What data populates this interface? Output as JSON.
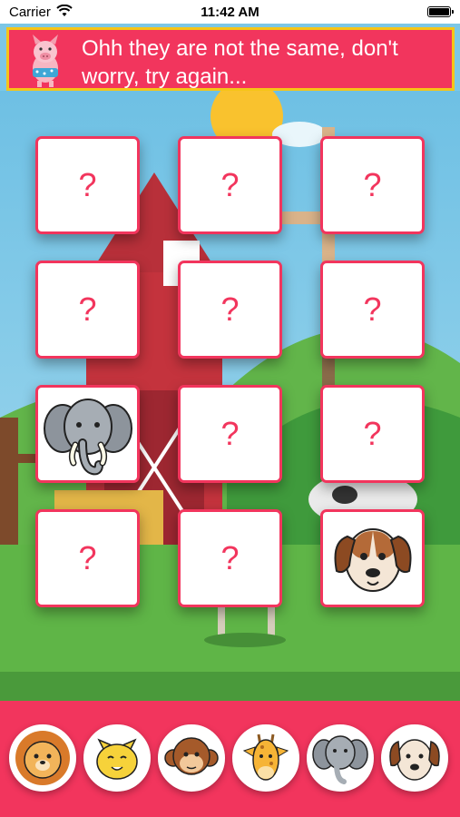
{
  "status_bar": {
    "carrier": "Carrier",
    "time": "11:42 AM"
  },
  "banner": {
    "message": "Ohh they are not the same, don't worry, try again..."
  },
  "board": {
    "cards": [
      {
        "state": "hidden",
        "label": "?"
      },
      {
        "state": "hidden",
        "label": "?"
      },
      {
        "state": "hidden",
        "label": "?"
      },
      {
        "state": "hidden",
        "label": "?"
      },
      {
        "state": "hidden",
        "label": "?"
      },
      {
        "state": "hidden",
        "label": "?"
      },
      {
        "state": "revealed",
        "animal": "elephant-icon"
      },
      {
        "state": "hidden",
        "label": "?"
      },
      {
        "state": "hidden",
        "label": "?"
      },
      {
        "state": "hidden",
        "label": "?"
      },
      {
        "state": "hidden",
        "label": "?"
      },
      {
        "state": "revealed",
        "animal": "dog-icon"
      }
    ]
  },
  "tray": {
    "animals": [
      "lion-icon",
      "cat-icon",
      "monkey-icon",
      "giraffe-icon",
      "elephant-icon",
      "dog-icon"
    ]
  },
  "colors": {
    "accent": "#f2355d",
    "banner_border": "#f5c518"
  }
}
